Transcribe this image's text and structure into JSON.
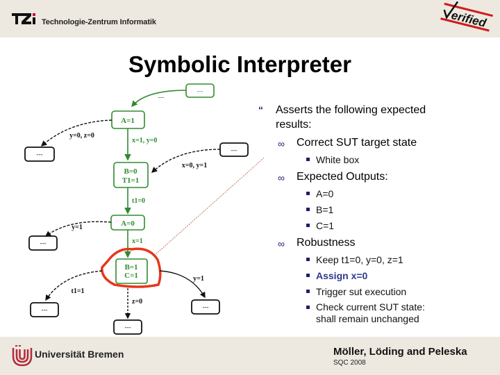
{
  "header": {
    "org_logo": "TZi",
    "org_name": "Technologie-Zentrum Informatik",
    "badge": "Verified"
  },
  "slide": {
    "title": "Symbolic Interpreter"
  },
  "diagram": {
    "states": [
      {
        "id": "s_A1",
        "label": [
          "A=1"
        ]
      },
      {
        "id": "s_B0",
        "label": [
          "B=0",
          "T1=1"
        ]
      },
      {
        "id": "s_A0",
        "label": [
          "A=0"
        ]
      },
      {
        "id": "s_B1",
        "label": [
          "B=1",
          "C=1"
        ]
      }
    ],
    "other_state_label": "---",
    "transitions": [
      {
        "from": "other_top",
        "to": "s_A1",
        "label": "---"
      },
      {
        "from": "s_A1",
        "to": "other_left1",
        "label": "y=0, z=0"
      },
      {
        "from": "s_A1",
        "to": "s_B0",
        "label": "x=1, y=0"
      },
      {
        "from": "other_right1",
        "to": "s_B0",
        "label": "x=0, y=1"
      },
      {
        "from": "s_B0",
        "to": "s_A0",
        "label": "t1=0"
      },
      {
        "from": "s_A0",
        "to": "other_left2",
        "label": "y=1"
      },
      {
        "from": "s_A0",
        "to": "s_B1",
        "label": "x=1"
      },
      {
        "from": "s_B1",
        "to": "other_left3",
        "label": "t1=1"
      },
      {
        "from": "s_B1",
        "to": "other_bottom",
        "label": "z=0"
      },
      {
        "from": "s_B1",
        "to": "other_right3",
        "label": "y=1"
      }
    ],
    "highlighted_state": "s_B1"
  },
  "content": {
    "main_bullet": "Asserts the following expected results:",
    "main_bullet_line1": "Asserts the following expected",
    "main_bullet_line2": "results:",
    "sections": [
      {
        "heading": "Correct SUT target state",
        "items": [
          "White box"
        ]
      },
      {
        "heading": "Expected Outputs:",
        "items": [
          "A=0",
          "B=1",
          "C=1"
        ]
      },
      {
        "heading": "Robustness",
        "items": [
          "Keep t1=0, y=0, z=1",
          "Assign x=0",
          "Trigger sut execution",
          "Check current SUT state: shall remain unchanged"
        ],
        "item4_line1": "Check current SUT state:",
        "item4_line2": "shall remain unchanged"
      }
    ],
    "marker_l1": "“",
    "marker_l2": "∞"
  },
  "footer": {
    "university": "Universität Bremen",
    "authors": "Möller, Löding and Peleska",
    "conference": "SQC 2008"
  },
  "colors": {
    "state_green": "#2e8b2e",
    "highlight_red": "#e8361a",
    "bullet_navy": "#1a1f6e",
    "emphasis_blue": "#2e3a8c",
    "band_beige": "#ede9e0"
  }
}
